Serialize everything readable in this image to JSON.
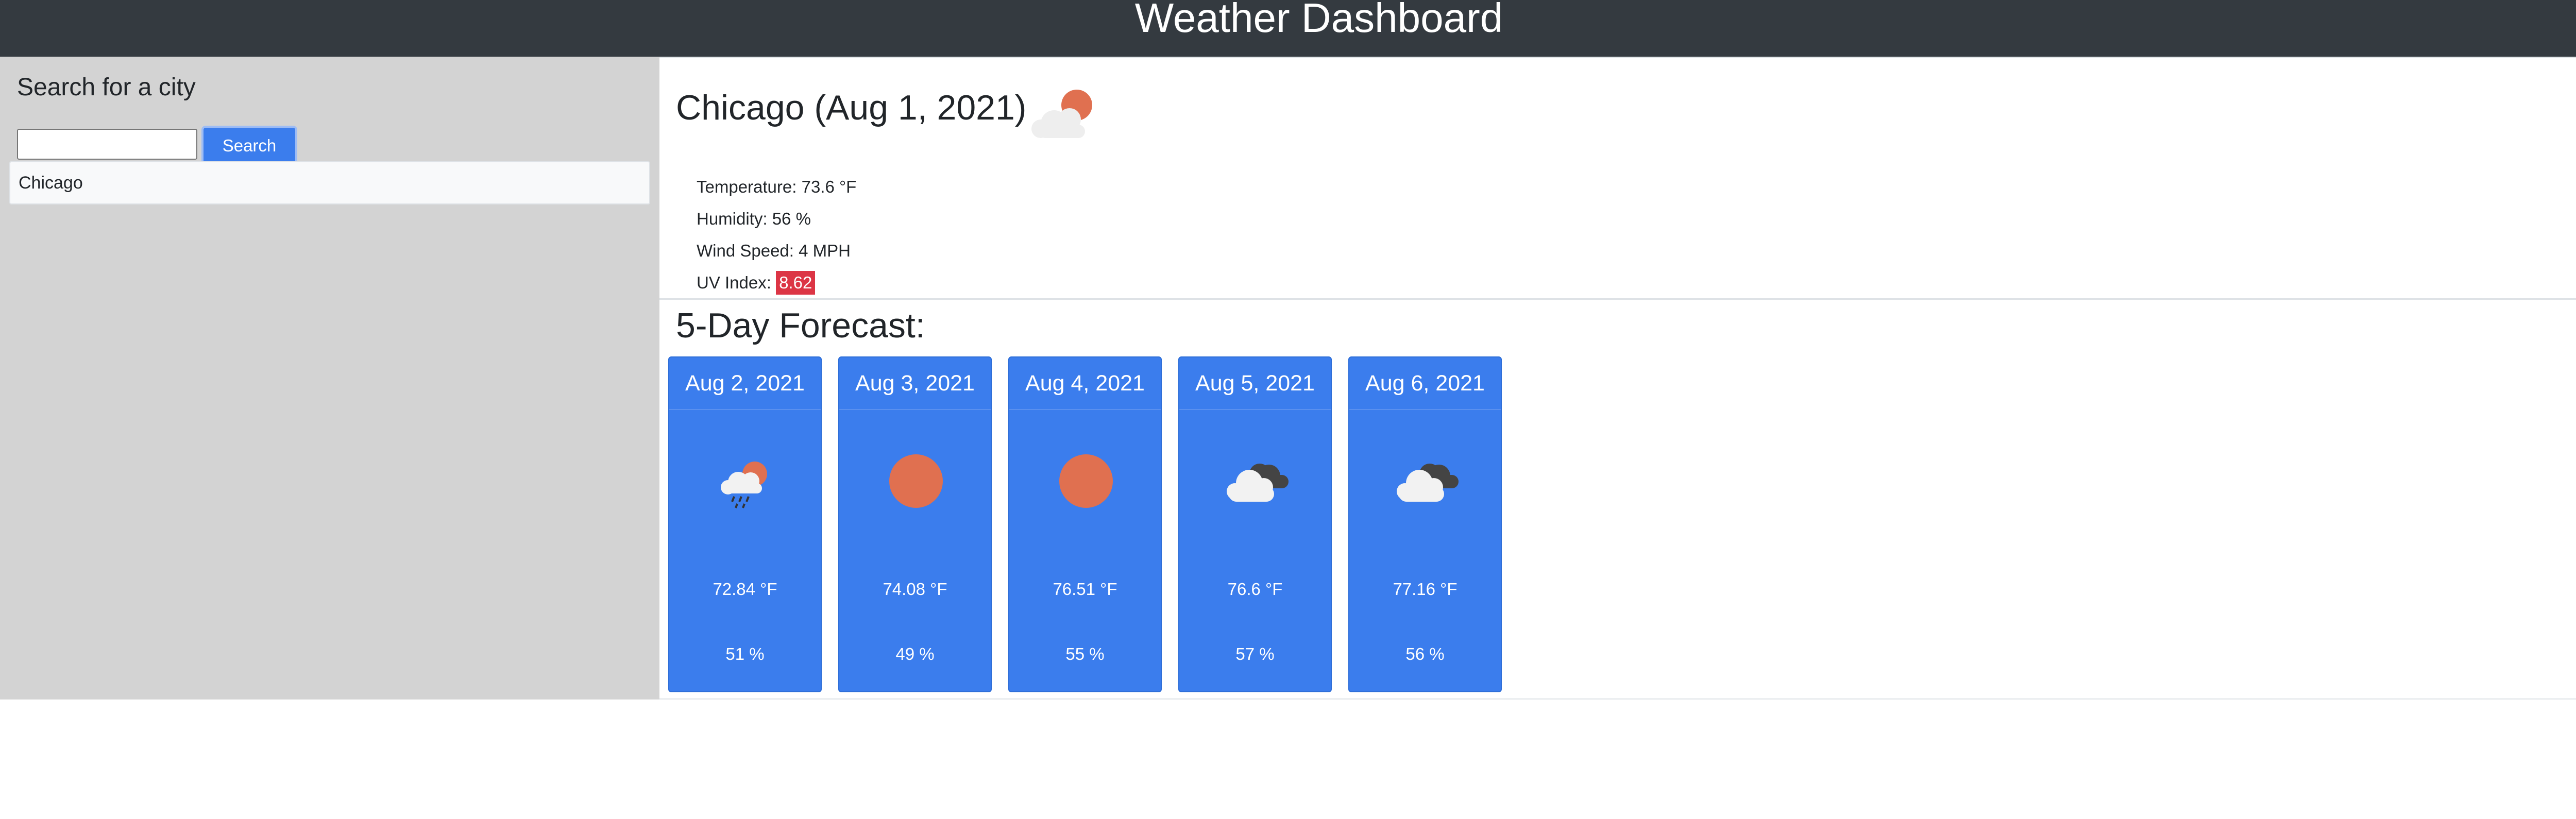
{
  "header": {
    "title": "Weather Dashboard"
  },
  "sidebar": {
    "heading": "Search for a city",
    "search_value": "",
    "search_button": "Search",
    "history": [
      "Chicago"
    ]
  },
  "current": {
    "title": "Chicago (Aug 1, 2021)",
    "icon": "partly-cloudy-icon",
    "temperature": "Temperature: 73.6 °F",
    "humidity": "Humidity: 56 %",
    "wind": "Wind Speed: 4 MPH",
    "uv_label": "UV Index: ",
    "uv_value": "8.62",
    "uv_color": "#dc3545"
  },
  "forecast": {
    "title": "5-Day Forecast:",
    "days": [
      {
        "date": "Aug 2, 2021",
        "icon": "rain-sun-icon",
        "temp": "72.84 °F",
        "humidity": "51 %"
      },
      {
        "date": "Aug 3, 2021",
        "icon": "sun-icon",
        "temp": "74.08 °F",
        "humidity": "49 %"
      },
      {
        "date": "Aug 4, 2021",
        "icon": "sun-icon",
        "temp": "76.51 °F",
        "humidity": "55 %"
      },
      {
        "date": "Aug 5, 2021",
        "icon": "clouds-icon",
        "temp": "76.6 °F",
        "humidity": "57 %"
      },
      {
        "date": "Aug 6, 2021",
        "icon": "clouds-icon",
        "temp": "77.16 °F",
        "humidity": "56 %"
      }
    ]
  },
  "colors": {
    "header_bg": "#343a40",
    "sidebar_bg": "#d3d3d3",
    "card_bg": "#3b7ded",
    "sun": "#e07050"
  }
}
